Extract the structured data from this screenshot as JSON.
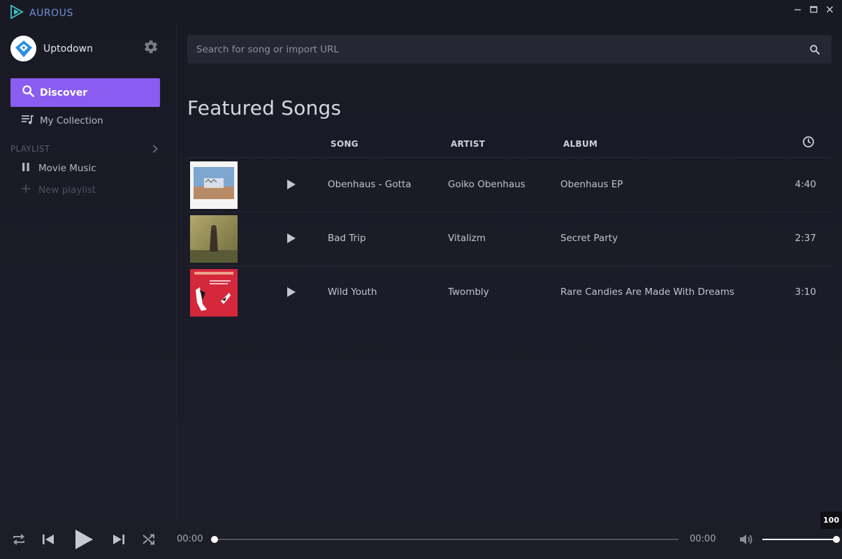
{
  "app": {
    "name": "AUROUS",
    "brand_color": "#6f8fd9",
    "accent": "#8b5cf0"
  },
  "window_controls": [
    "minimize-icon",
    "maximize-icon",
    "close-icon"
  ],
  "sidebar": {
    "user_name": "Uptodown",
    "nav": [
      {
        "label": "Discover",
        "icon": "search-icon",
        "active": true
      },
      {
        "label": "My Collection",
        "icon": "playlist-icon",
        "active": false
      }
    ],
    "playlist_header": "PLAYLIST",
    "playlists": [
      {
        "label": "Movie Music",
        "icon": "pause-icon"
      }
    ],
    "new_playlist_label": "New playlist"
  },
  "search": {
    "placeholder": "Search for song or import URL",
    "value": ""
  },
  "main": {
    "title": "Featured Songs",
    "columns": {
      "song": "SONG",
      "artist": "ARTIST",
      "album": "ALBUM",
      "duration": "clock-icon"
    },
    "songs": [
      {
        "song": "Obenhaus - Gotta",
        "artist": "Goiko Obenhaus",
        "album": "Obenhaus EP",
        "duration": "4:40"
      },
      {
        "song": "Bad Trip",
        "artist": "Vitalizm",
        "album": "Secret Party",
        "duration": "2:37"
      },
      {
        "song": "Wild Youth",
        "artist": "Twombly",
        "album": "Rare Candies Are Made With Dreams",
        "duration": "3:10"
      }
    ]
  },
  "player": {
    "current_time": "00:00",
    "total_time": "00:00",
    "progress": 0,
    "volume": 100,
    "volume_label": "100"
  }
}
